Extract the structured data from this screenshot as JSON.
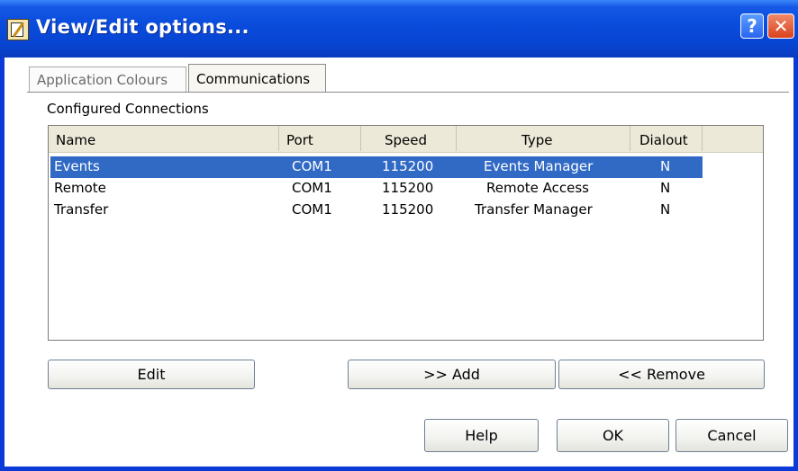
{
  "window": {
    "title": "View/Edit options...",
    "help_button": "?",
    "close_button": "✕"
  },
  "tabs": [
    {
      "label": "Application Colours",
      "active": false
    },
    {
      "label": "Communications",
      "active": true
    }
  ],
  "connections": {
    "group_label": "Configured Connections",
    "columns": [
      "Name",
      "Port",
      "Speed",
      "Type",
      "Dialout"
    ],
    "rows": [
      {
        "name": "Events",
        "port": "COM1",
        "speed": "115200",
        "type": "Events Manager",
        "dialout": "N",
        "selected": true
      },
      {
        "name": "Remote",
        "port": "COM1",
        "speed": "115200",
        "type": "Remote Access",
        "dialout": "N",
        "selected": false
      },
      {
        "name": "Transfer",
        "port": "COM1",
        "speed": "115200",
        "type": "Transfer Manager",
        "dialout": "N",
        "selected": false
      }
    ]
  },
  "buttons": {
    "edit": "Edit",
    "add": ">> Add",
    "remove": "<< Remove",
    "help": "Help",
    "ok": "OK",
    "cancel": "Cancel"
  },
  "colors": {
    "titlebar": "#0a4cdc",
    "selection": "#316ac5",
    "header": "#ece9d8"
  }
}
